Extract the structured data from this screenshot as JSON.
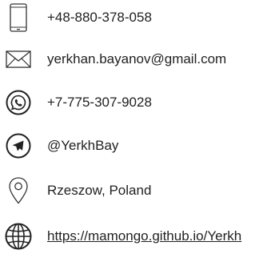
{
  "contacts": {
    "phone": {
      "text": "+48-880-378-058",
      "icon": "smartphone-icon"
    },
    "email": {
      "text": "yerkhan.bayanov@gmail.com",
      "icon": "envelope-icon"
    },
    "whatsapp": {
      "text": "+7-775-307-9028",
      "icon": "whatsapp-icon"
    },
    "telegram": {
      "text": "@YerkhBay",
      "icon": "telegram-icon"
    },
    "location": {
      "text": "Rzeszow, Poland",
      "icon": "map-pin-icon"
    },
    "website": {
      "text": "https://mamongo.github.io/Yerkh",
      "icon": "globe-icon"
    }
  },
  "colors": {
    "text": "#222222",
    "icon": "#333333",
    "background": "#ffffff"
  }
}
